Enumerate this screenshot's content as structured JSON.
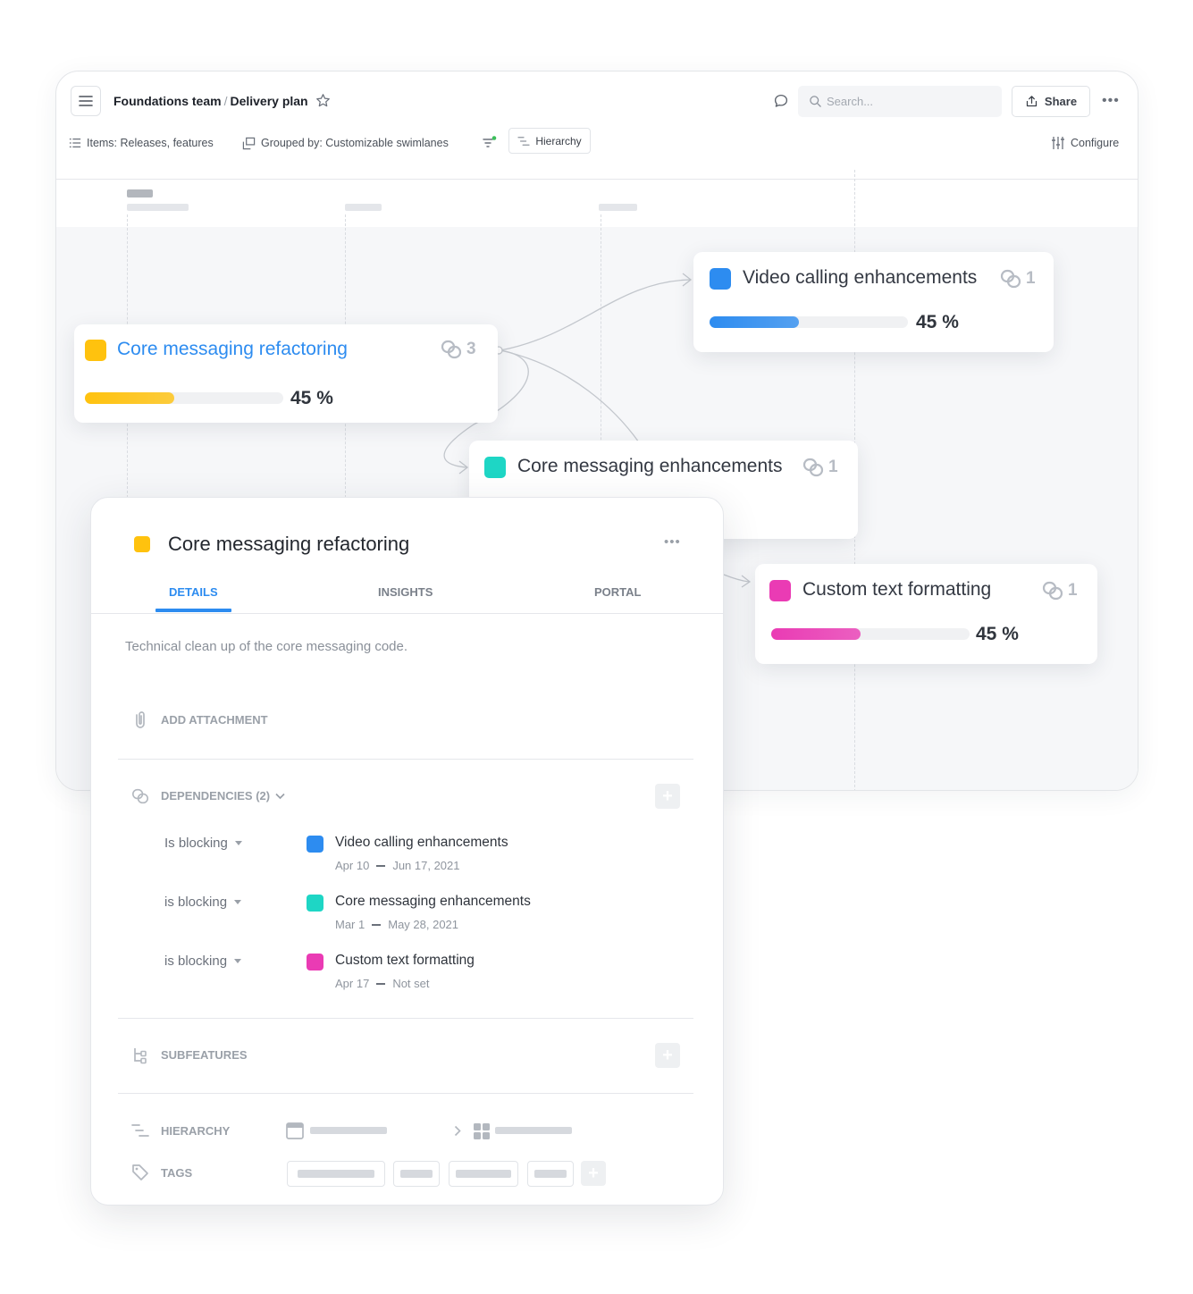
{
  "header": {
    "team": "Foundations team",
    "separator": "/",
    "plan": "Delivery plan",
    "search_placeholder": "Search...",
    "share_label": "Share"
  },
  "toolbar": {
    "items_label": "Items: Releases, features",
    "grouped_label": "Grouped by: Customizable swimlanes",
    "hierarchy_label": "Hierarchy",
    "configure_label": "Configure"
  },
  "timeline_cards": [
    {
      "title": "Core messaging refactoring",
      "dependencies": "3",
      "progress": 45,
      "progress_label": "45 %",
      "color": "#FFC20E",
      "title_color": "#2D8CF0"
    },
    {
      "title": "Video calling enhancements",
      "dependencies": "1",
      "progress": 45,
      "progress_label": "45 %",
      "color": "#2D8CF0"
    },
    {
      "title": "Core messaging enhancements",
      "dependencies": "1",
      "color": "#1ED6C5"
    },
    {
      "title": "Custom text formatting",
      "dependencies": "1",
      "progress": 45,
      "progress_label": "45 %",
      "color": "#EA3BB4"
    }
  ],
  "panel": {
    "title": "Core messaging refactoring",
    "color": "#FFC20E",
    "tabs": [
      "DETAILS",
      "INSIGHTS",
      "PORTAL"
    ],
    "active_tab": "DETAILS",
    "description": "Technical clean up of the core messaging code.",
    "add_attachment": "ADD ATTACHMENT",
    "dependencies_label": "DEPENDENCIES (2)",
    "dependencies": [
      {
        "relation": "Is blocking",
        "name": "Video calling enhancements",
        "start": "Apr 10",
        "end": "Jun 17, 2021",
        "color": "#2D8CF0"
      },
      {
        "relation": "is blocking",
        "name": "Core messaging enhancements",
        "start": "Mar 1",
        "end": "May 28, 2021",
        "color": "#1ED6C5"
      },
      {
        "relation": "is blocking",
        "name": "Custom text formatting",
        "start": "Apr 17",
        "end": "Not set",
        "color": "#EA3BB4"
      }
    ],
    "subfeatures_label": "SUBFEATURES",
    "hierarchy_label": "HIERARCHY",
    "tags_label": "TAGS"
  }
}
